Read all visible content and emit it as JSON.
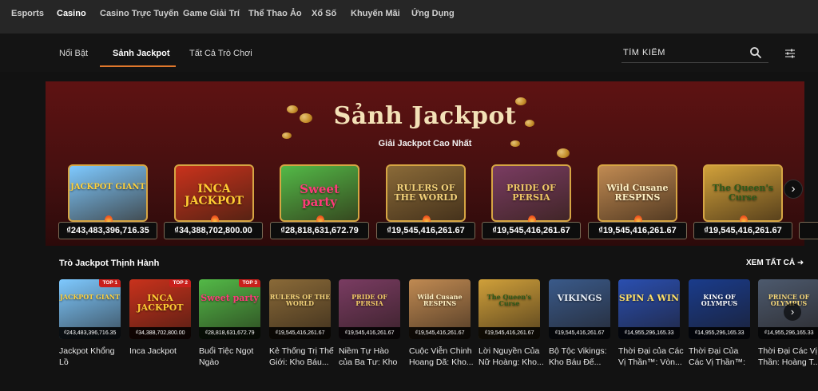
{
  "topnav": {
    "items": [
      "Esports",
      "Casino",
      "Casino Trực Tuyến",
      "Game Giải Trí",
      "Thể Thao Ảo",
      "Xổ Số",
      "Khuyến Mãi",
      "Ứng Dụng"
    ],
    "active": "Casino"
  },
  "tabs": [
    {
      "label": "Nổi Bật"
    },
    {
      "label": "Sảnh Jackpot",
      "active": true
    },
    {
      "label": "Tất Cả Trò Chơi"
    }
  ],
  "search": {
    "placeholder": "TÌM KIẾM",
    "icon": "search-icon"
  },
  "filter_icon": "filter-sliders-icon",
  "hero": {
    "title": "Sảnh Jackpot",
    "subtitle": "Giải Jackpot Cao Nhất"
  },
  "jackpots": [
    {
      "logo": "JACKPOT GIANT",
      "amount": "₫243,483,396,716.35",
      "bg": "#7ec9ff",
      "color": "#ffd23e"
    },
    {
      "logo": "INCA JACKPOT",
      "amount": "₫34,388,702,800.00",
      "bg": "#c9321c",
      "color": "#ffcc33"
    },
    {
      "logo": "Sweet party",
      "amount": "₫28,818,631,672.79",
      "bg": "#53b947",
      "color": "#ff3b7a"
    },
    {
      "logo": "RULERS OF THE WORLD",
      "amount": "₫19,545,416,261.67",
      "bg": "#8a6a38",
      "color": "#f3d27a"
    },
    {
      "logo": "PRIDE OF PERSIA",
      "amount": "₫19,545,416,261.67",
      "bg": "#7a3c62",
      "color": "#f0c866"
    },
    {
      "logo": "Wild Cusane RESPINS",
      "amount": "₫19,545,416,261.67",
      "bg": "#c08a52",
      "color": "#fff1c4"
    },
    {
      "logo": "The Queen's Curse",
      "amount": "₫19,545,416,261.67",
      "bg": "#d0a03a",
      "color": "#2f5a1a"
    }
  ],
  "trending": {
    "title": "Trò Jackpot Thịnh Hành",
    "see_all": "XEM TẤT CẢ",
    "items": [
      {
        "logo": "JACKPOT GIANT",
        "amount": "₫243,483,396,716.35",
        "badge": "TOP 1",
        "name": "Jackpot Khổng Lồ",
        "bg": "#7ec9ff",
        "color": "#ffd23e"
      },
      {
        "logo": "INCA JACKPOT",
        "amount": "₫34,388,702,800.00",
        "badge": "TOP 2",
        "name": "Inca Jackpot",
        "bg": "#c9321c",
        "color": "#ffcc33"
      },
      {
        "logo": "Sweet party",
        "amount": "₫28,818,631,672.79",
        "badge": "TOP 3",
        "name": "Buổi Tiệc Ngọt Ngào",
        "bg": "#53b947",
        "color": "#ff3b7a"
      },
      {
        "logo": "RULERS OF THE WORLD",
        "amount": "₫19,545,416,261.67",
        "badge": "",
        "name": "Kẻ Thống Trị Thế Giới: Kho Báu...",
        "bg": "#8a6a38",
        "color": "#f3d27a"
      },
      {
        "logo": "PRIDE OF PERSIA",
        "amount": "₫19,545,416,261.67",
        "badge": "",
        "name": "Niềm Tự Hào của Ba Tư: Kho Báu...",
        "bg": "#7a3c62",
        "color": "#f0c866"
      },
      {
        "logo": "Wild Cusane RESPINS",
        "amount": "₫19,545,416,261.67",
        "badge": "",
        "name": "Cuộc Viễn Chinh Hoang Dã: Kho...",
        "bg": "#c08a52",
        "color": "#fff1c4"
      },
      {
        "logo": "The Queen's Curse",
        "amount": "₫19,545,416,261.67",
        "badge": "",
        "name": "Lời Nguyền Của Nữ Hoàng: Kho...",
        "bg": "#d0a03a",
        "color": "#2f5a1a"
      },
      {
        "logo": "VIKINGS",
        "amount": "₫19,545,416,261.67",
        "badge": "",
        "name": "Bộ Tộc Vikings: Kho Báu Đế...",
        "bg": "#3a5a8a",
        "color": "#e8eef6"
      },
      {
        "logo": "SPIN A WIN",
        "amount": "₫14,955,296,165.33",
        "badge": "",
        "name": "Thời Đại của Các Vị Thần™: Vòn...",
        "bg": "#2a4fb0",
        "color": "#ffe066"
      },
      {
        "logo": "KING OF OLYMPUS",
        "amount": "₫14,955,296,165.33",
        "badge": "",
        "name": "Thời Đại Của Các Vị Thần™: Vua...",
        "bg": "#1a3c8c",
        "color": "#ffffff"
      },
      {
        "logo": "PRINCE OF OLYMPUS",
        "amount": "₫14,955,296,165.33",
        "badge": "",
        "name": "Thời Đại Các Vị Thần: Hoàng T...",
        "bg": "#4d5a6e",
        "color": "#f5d77a"
      }
    ]
  }
}
